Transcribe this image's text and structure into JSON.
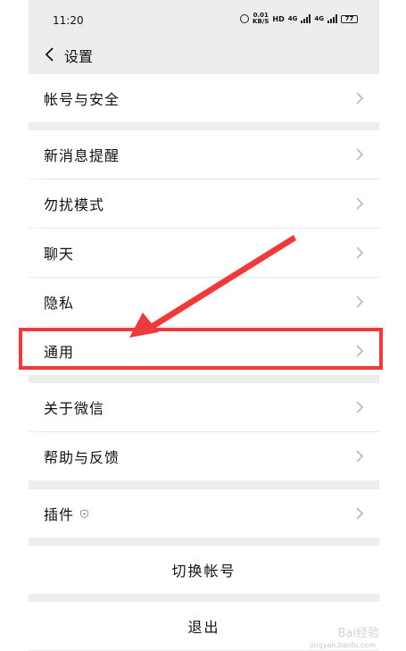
{
  "status_bar": {
    "time": "11:20",
    "speed_top": "0.01",
    "speed_bottom": "KB/S",
    "hd": "HD",
    "signal_tag": "4G",
    "battery": "77"
  },
  "nav": {
    "title": "设置",
    "back_icon": "chevron-left-icon"
  },
  "rows": {
    "account_security": "帐号与安全",
    "new_message_alerts": "新消息提醒",
    "do_not_disturb": "勿扰模式",
    "chat": "聊天",
    "privacy": "隐私",
    "general": "通用",
    "about_wechat": "关于微信",
    "help_feedback": "帮助与反馈",
    "plugins": "插件",
    "switch_account": "切换帐号",
    "logout": "退出"
  },
  "annotation": {
    "highlight_color": "#ee3a3a"
  },
  "watermark": {
    "main": "Bai经验",
    "sub": "jingyan.baidu.com"
  },
  "colors": {
    "background": "#ededed",
    "row_bg": "#ffffff",
    "chevron": "#b2b2b2"
  }
}
